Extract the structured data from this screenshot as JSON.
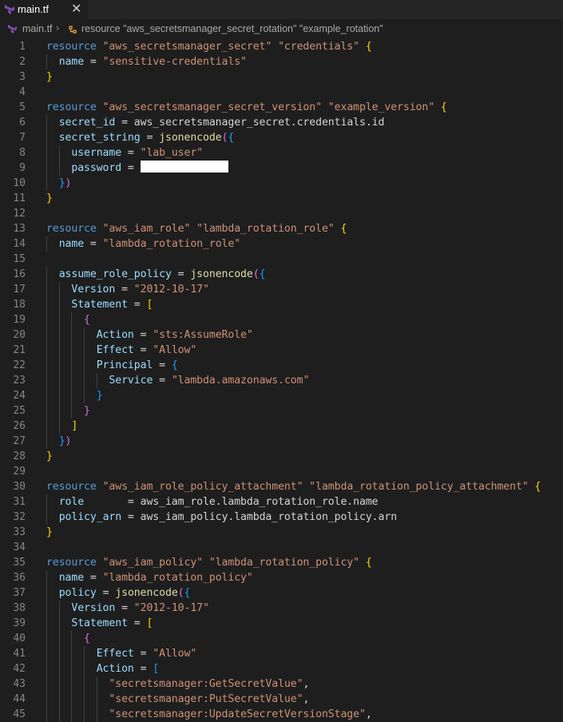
{
  "tab": {
    "label": "main.tf",
    "close_symbol": "✕"
  },
  "breadcrumb": {
    "file": "main.tf",
    "separator": "›",
    "symbol": "resource \"aws_secretsmanager_secret_rotation\" \"example_rotation\""
  },
  "colors": {
    "keyword": "#569cd6",
    "string": "#ce9178",
    "property": "#9cdcfe",
    "function": "#dcdcaa",
    "bracket1": "#ffd700",
    "bracket2": "#da70d6",
    "bracket3": "#179fff",
    "line_number": "#858585",
    "background": "#1e1e1e"
  },
  "lines": [
    [
      [
        "kw",
        "resource"
      ],
      [
        "id",
        " "
      ],
      [
        "str",
        "\"aws_secretsmanager_secret\""
      ],
      [
        "id",
        " "
      ],
      [
        "str",
        "\"credentials\""
      ],
      [
        "id",
        " "
      ],
      [
        "b1",
        "{"
      ]
    ],
    [
      [
        "id",
        "  "
      ],
      [
        "prop",
        "name"
      ],
      [
        "id",
        " = "
      ],
      [
        "str",
        "\"sensitive-credentials\""
      ]
    ],
    [
      [
        "b1",
        "}"
      ]
    ],
    [],
    [
      [
        "kw",
        "resource"
      ],
      [
        "id",
        " "
      ],
      [
        "str",
        "\"aws_secretsmanager_secret_version\""
      ],
      [
        "id",
        " "
      ],
      [
        "str",
        "\"example_version\""
      ],
      [
        "id",
        " "
      ],
      [
        "b1",
        "{"
      ]
    ],
    [
      [
        "id",
        "  "
      ],
      [
        "prop",
        "secret_id"
      ],
      [
        "id",
        " = aws_secretsmanager_secret.credentials.id"
      ]
    ],
    [
      [
        "id",
        "  "
      ],
      [
        "prop",
        "secret_string"
      ],
      [
        "id",
        " = "
      ],
      [
        "fn",
        "jsonencode"
      ],
      [
        "b2",
        "("
      ],
      [
        "b3",
        "{"
      ]
    ],
    [
      [
        "id",
        "    "
      ],
      [
        "prop",
        "username"
      ],
      [
        "id",
        " = "
      ],
      [
        "str",
        "\"lab_user\""
      ]
    ],
    [
      [
        "id",
        "    "
      ],
      [
        "prop",
        "password"
      ],
      [
        "id",
        " = "
      ],
      [
        "redact",
        ""
      ]
    ],
    [
      [
        "id",
        "  "
      ],
      [
        "b3",
        "}"
      ],
      [
        "b2",
        ")"
      ]
    ],
    [
      [
        "b1",
        "}"
      ]
    ],
    [],
    [
      [
        "kw",
        "resource"
      ],
      [
        "id",
        " "
      ],
      [
        "str",
        "\"aws_iam_role\""
      ],
      [
        "id",
        " "
      ],
      [
        "str",
        "\"lambda_rotation_role\""
      ],
      [
        "id",
        " "
      ],
      [
        "b1",
        "{"
      ]
    ],
    [
      [
        "id",
        "  "
      ],
      [
        "prop",
        "name"
      ],
      [
        "id",
        " = "
      ],
      [
        "str",
        "\"lambda_rotation_role\""
      ]
    ],
    [],
    [
      [
        "id",
        "  "
      ],
      [
        "prop",
        "assume_role_policy"
      ],
      [
        "id",
        " = "
      ],
      [
        "fn",
        "jsonencode"
      ],
      [
        "b2",
        "("
      ],
      [
        "b3",
        "{"
      ]
    ],
    [
      [
        "id",
        "    "
      ],
      [
        "prop",
        "Version"
      ],
      [
        "id",
        " = "
      ],
      [
        "str",
        "\"2012-10-17\""
      ]
    ],
    [
      [
        "id",
        "    "
      ],
      [
        "prop",
        "Statement"
      ],
      [
        "id",
        " = "
      ],
      [
        "b1",
        "["
      ]
    ],
    [
      [
        "id",
        "      "
      ],
      [
        "b2",
        "{"
      ]
    ],
    [
      [
        "id",
        "        "
      ],
      [
        "prop",
        "Action"
      ],
      [
        "id",
        " = "
      ],
      [
        "str",
        "\"sts:AssumeRole\""
      ]
    ],
    [
      [
        "id",
        "        "
      ],
      [
        "prop",
        "Effect"
      ],
      [
        "id",
        " = "
      ],
      [
        "str",
        "\"Allow\""
      ]
    ],
    [
      [
        "id",
        "        "
      ],
      [
        "prop",
        "Principal"
      ],
      [
        "id",
        " = "
      ],
      [
        "b3",
        "{"
      ]
    ],
    [
      [
        "id",
        "          "
      ],
      [
        "prop",
        "Service"
      ],
      [
        "id",
        " = "
      ],
      [
        "str",
        "\"lambda.amazonaws.com\""
      ]
    ],
    [
      [
        "id",
        "        "
      ],
      [
        "b3",
        "}"
      ]
    ],
    [
      [
        "id",
        "      "
      ],
      [
        "b2",
        "}"
      ]
    ],
    [
      [
        "id",
        "    "
      ],
      [
        "b1",
        "]"
      ]
    ],
    [
      [
        "id",
        "  "
      ],
      [
        "b3",
        "}"
      ],
      [
        "b2",
        ")"
      ]
    ],
    [
      [
        "b1",
        "}"
      ]
    ],
    [],
    [
      [
        "kw",
        "resource"
      ],
      [
        "id",
        " "
      ],
      [
        "str",
        "\"aws_iam_role_policy_attachment\""
      ],
      [
        "id",
        " "
      ],
      [
        "str",
        "\"lambda_rotation_policy_attachment\""
      ],
      [
        "id",
        " "
      ],
      [
        "b1",
        "{"
      ]
    ],
    [
      [
        "id",
        "  "
      ],
      [
        "prop",
        "role"
      ],
      [
        "id",
        "       = aws_iam_role.lambda_rotation_role.name"
      ]
    ],
    [
      [
        "id",
        "  "
      ],
      [
        "prop",
        "policy_arn"
      ],
      [
        "id",
        " = aws_iam_policy.lambda_rotation_policy.arn"
      ]
    ],
    [
      [
        "b1",
        "}"
      ]
    ],
    [],
    [
      [
        "kw",
        "resource"
      ],
      [
        "id",
        " "
      ],
      [
        "str",
        "\"aws_iam_policy\""
      ],
      [
        "id",
        " "
      ],
      [
        "str",
        "\"lambda_rotation_policy\""
      ],
      [
        "id",
        " "
      ],
      [
        "b1",
        "{"
      ]
    ],
    [
      [
        "id",
        "  "
      ],
      [
        "prop",
        "name"
      ],
      [
        "id",
        " = "
      ],
      [
        "str",
        "\"lambda_rotation_policy\""
      ]
    ],
    [
      [
        "id",
        "  "
      ],
      [
        "prop",
        "policy"
      ],
      [
        "id",
        " = "
      ],
      [
        "fn",
        "jsonencode"
      ],
      [
        "b2",
        "("
      ],
      [
        "b3",
        "{"
      ]
    ],
    [
      [
        "id",
        "    "
      ],
      [
        "prop",
        "Version"
      ],
      [
        "id",
        " = "
      ],
      [
        "str",
        "\"2012-10-17\""
      ]
    ],
    [
      [
        "id",
        "    "
      ],
      [
        "prop",
        "Statement"
      ],
      [
        "id",
        " = "
      ],
      [
        "b1",
        "["
      ]
    ],
    [
      [
        "id",
        "      "
      ],
      [
        "b2",
        "{"
      ]
    ],
    [
      [
        "id",
        "        "
      ],
      [
        "prop",
        "Effect"
      ],
      [
        "id",
        " = "
      ],
      [
        "str",
        "\"Allow\""
      ]
    ],
    [
      [
        "id",
        "        "
      ],
      [
        "prop",
        "Action"
      ],
      [
        "id",
        " = "
      ],
      [
        "b3",
        "["
      ]
    ],
    [
      [
        "id",
        "          "
      ],
      [
        "str",
        "\"secretsmanager:GetSecretValue\""
      ],
      [
        "id",
        ","
      ]
    ],
    [
      [
        "id",
        "          "
      ],
      [
        "str",
        "\"secretsmanager:PutSecretValue\""
      ],
      [
        "id",
        ","
      ]
    ],
    [
      [
        "id",
        "          "
      ],
      [
        "str",
        "\"secretsmanager:UpdateSecretVersionStage\""
      ],
      [
        "id",
        ","
      ]
    ]
  ]
}
